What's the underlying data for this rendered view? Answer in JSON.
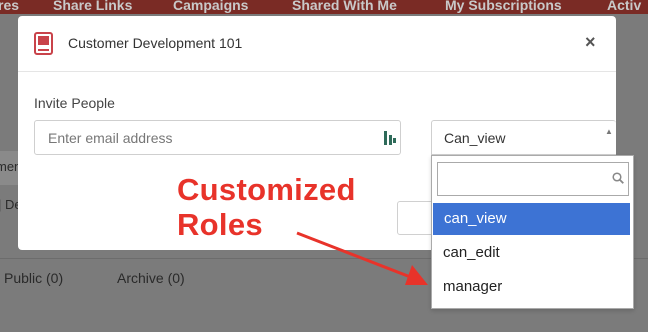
{
  "nav": {
    "items": [
      "res",
      "Share Links",
      "Campaigns",
      "Shared With Me",
      "My Subscriptions",
      "Activ"
    ]
  },
  "background": {
    "left_fragment_1": "men",
    "left_fragment_2": "| De",
    "tab_public": "Public (0)",
    "tab_archive": "Archive (0)"
  },
  "modal": {
    "title": "Customer Development 101",
    "close_label": "×",
    "invite_label": "Invite People",
    "email_placeholder": "Enter email address",
    "role_selected": "Can_view"
  },
  "dropdown": {
    "search_value": "",
    "options": [
      "can_view",
      "can_edit",
      "manager"
    ],
    "selected_index": 0
  },
  "annotation": {
    "line1": "Customized",
    "line2": "Roles",
    "color": "#e8332a"
  },
  "colors": {
    "nav_bg": "#7a2b25",
    "selected_option_bg": "#3d73d4",
    "book_icon": "#c9434a"
  }
}
